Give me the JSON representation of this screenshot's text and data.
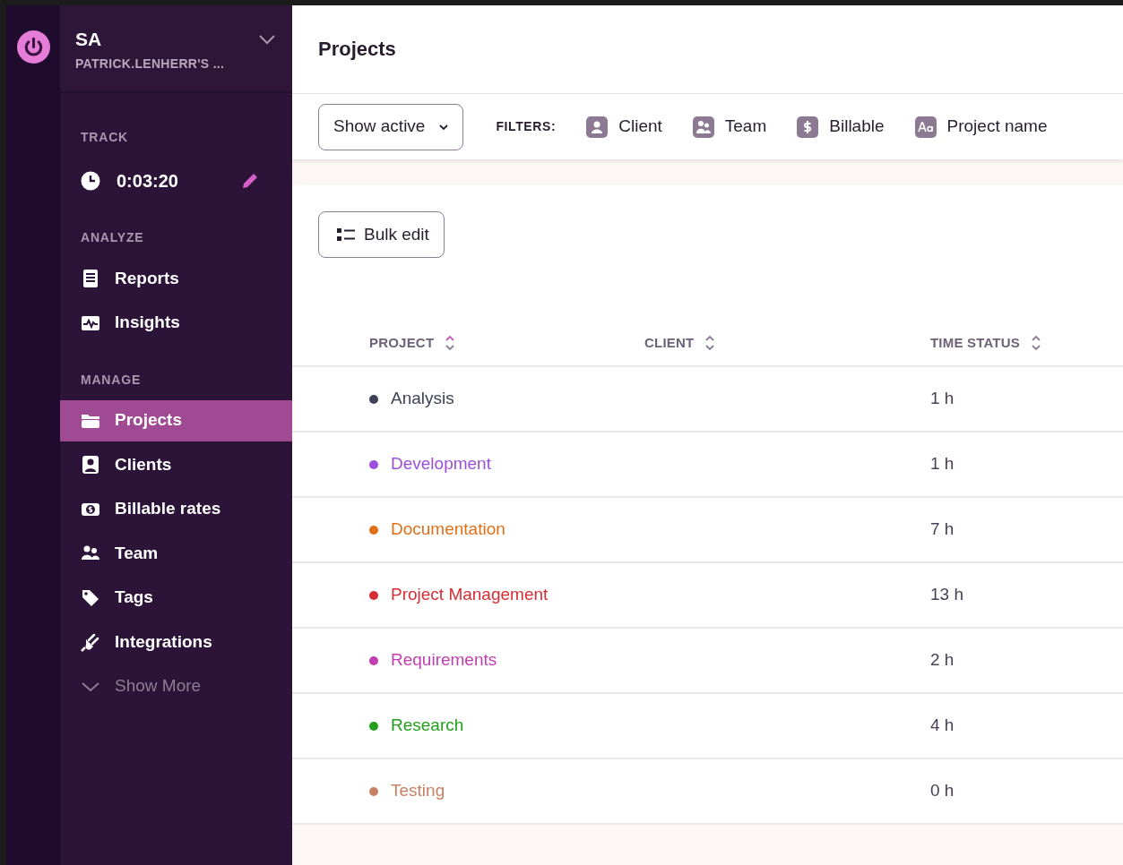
{
  "workspace": {
    "initials": "SA",
    "name": "PATRICK.LENHERR'S ..."
  },
  "track": {
    "heading": "TRACK",
    "timer": "0:03:20"
  },
  "analyze": {
    "heading": "ANALYZE",
    "items": [
      {
        "label": "Reports",
        "selected": false
      },
      {
        "label": "Insights",
        "selected": false
      }
    ]
  },
  "manage": {
    "heading": "MANAGE",
    "items": [
      {
        "label": "Projects",
        "selected": true
      },
      {
        "label": "Clients",
        "selected": false
      },
      {
        "label": "Billable rates",
        "selected": false
      },
      {
        "label": "Team",
        "selected": false
      },
      {
        "label": "Tags",
        "selected": false
      },
      {
        "label": "Integrations",
        "selected": false
      }
    ],
    "show_more": "Show More"
  },
  "page": {
    "title": "Projects"
  },
  "toolbar": {
    "status_filter": "Show active",
    "filters_label": "FILTERS:",
    "filters": [
      "Client",
      "Team",
      "Billable",
      "Project name"
    ]
  },
  "bulk_edit": "Bulk edit",
  "table": {
    "columns": [
      "PROJECT",
      "CLIENT",
      "TIME STATUS"
    ],
    "rows": [
      {
        "project": "Analysis",
        "color": "#3d4256",
        "time_status": "1 h"
      },
      {
        "project": "Development",
        "color": "#9b4fdc",
        "time_status": "1 h"
      },
      {
        "project": "Documentation",
        "color": "#e2701a",
        "time_status": "7 h"
      },
      {
        "project": "Project Management",
        "color": "#d62d35",
        "time_status": "13 h"
      },
      {
        "project": "Requirements",
        "color": "#c23eb0",
        "time_status": "2 h"
      },
      {
        "project": "Research",
        "color": "#22a01b",
        "time_status": "4 h"
      },
      {
        "project": "Testing",
        "color": "#c78063",
        "time_status": "0 h"
      }
    ]
  }
}
